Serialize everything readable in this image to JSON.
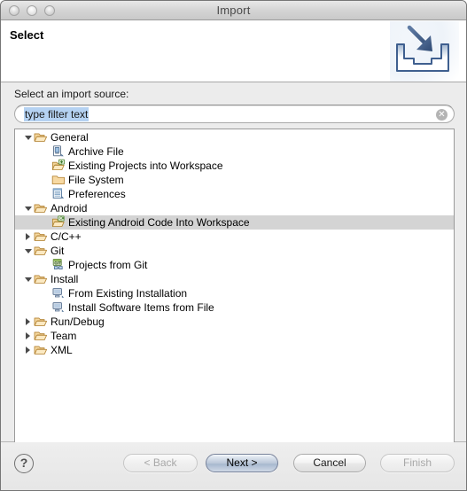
{
  "window": {
    "title": "Import",
    "traffic_lights": [
      "close",
      "minimize",
      "zoom"
    ]
  },
  "header": {
    "title": "Select",
    "icon": "import-tray-arrow-icon"
  },
  "body": {
    "source_label": "Select an import source:",
    "filter": {
      "value": "type filter text",
      "placeholder": "type filter text",
      "clear_glyph": "✕",
      "selected": true
    }
  },
  "tree": {
    "selected_index": 6,
    "rows": [
      {
        "label": "General",
        "depth": 0,
        "twisty": "down",
        "icon": "folder-open-icon"
      },
      {
        "label": "Archive File",
        "depth": 1,
        "twisty": "none",
        "icon": "archive-file-icon"
      },
      {
        "label": "Existing Projects into Workspace",
        "depth": 1,
        "twisty": "none",
        "icon": "import-projects-icon"
      },
      {
        "label": "File System",
        "depth": 1,
        "twisty": "none",
        "icon": "folder-icon"
      },
      {
        "label": "Preferences",
        "depth": 1,
        "twisty": "none",
        "icon": "preferences-sheet-icon"
      },
      {
        "label": "Android",
        "depth": 0,
        "twisty": "down",
        "icon": "folder-open-icon"
      },
      {
        "label": "Existing Android Code Into Workspace",
        "depth": 1,
        "twisty": "none",
        "icon": "android-project-icon"
      },
      {
        "label": "C/C++",
        "depth": 0,
        "twisty": "right",
        "icon": "folder-open-icon"
      },
      {
        "label": "Git",
        "depth": 0,
        "twisty": "down",
        "icon": "folder-open-icon"
      },
      {
        "label": "Projects from Git",
        "depth": 1,
        "twisty": "none",
        "icon": "git-icon"
      },
      {
        "label": "Install",
        "depth": 0,
        "twisty": "down",
        "icon": "folder-open-icon"
      },
      {
        "label": "From Existing Installation",
        "depth": 1,
        "twisty": "none",
        "icon": "computer-icon"
      },
      {
        "label": "Install Software Items from File",
        "depth": 1,
        "twisty": "none",
        "icon": "computer-icon"
      },
      {
        "label": "Run/Debug",
        "depth": 0,
        "twisty": "right",
        "icon": "folder-open-icon"
      },
      {
        "label": "Team",
        "depth": 0,
        "twisty": "right",
        "icon": "folder-open-icon"
      },
      {
        "label": "XML",
        "depth": 0,
        "twisty": "right",
        "icon": "folder-open-icon"
      }
    ]
  },
  "footer": {
    "help_glyph": "?",
    "buttons": [
      {
        "id": "back",
        "label": "< Back",
        "state": "disabled"
      },
      {
        "id": "next",
        "label": "Next >",
        "state": "default"
      },
      {
        "id": "cancel",
        "label": "Cancel",
        "state": "normal"
      },
      {
        "id": "finish",
        "label": "Finish",
        "state": "disabled"
      }
    ]
  },
  "colors": {
    "selection_row": "#d4d4d4",
    "text_selection": "#b5d2f2",
    "window_chrome": "#ececec",
    "folder_yellow": "#e8b86a",
    "accent_blue": "#3f5f8f"
  }
}
